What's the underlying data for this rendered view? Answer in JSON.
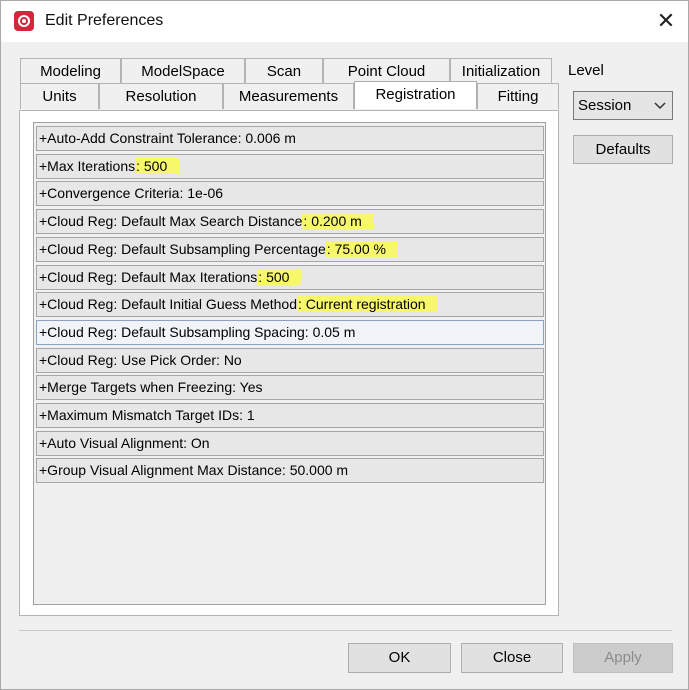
{
  "window": {
    "title": "Edit Preferences",
    "close_symbol": "✕"
  },
  "tabs_row1": [
    "Modeling",
    "ModelSpace",
    "Scan",
    "Point Cloud",
    "Initialization"
  ],
  "tabs_row2": [
    "Units",
    "Resolution",
    "Measurements",
    "Registration",
    "Fitting"
  ],
  "active_tab": "Registration",
  "level": {
    "label": "Level",
    "value": "Session"
  },
  "buttons": {
    "defaults": "Defaults",
    "ok": "OK",
    "close": "Close",
    "apply": "Apply"
  },
  "highlight_color": "#f7f76b",
  "preferences": [
    {
      "label": "+Auto-Add Constraint Tolerance",
      "sep": ": ",
      "value": "0.006 m",
      "highlighted": false
    },
    {
      "label": "+Max Iterations",
      "sep": ": ",
      "value": "500",
      "highlighted": true
    },
    {
      "label": "+Convergence Criteria",
      "sep": ": ",
      "value": "1e-06",
      "highlighted": false
    },
    {
      "label": "+Cloud Reg: Default Max Search Distance",
      "sep": ": ",
      "value": "0.200 m",
      "highlighted": true
    },
    {
      "label": "+Cloud Reg: Default Subsampling Percentage",
      "sep": ": ",
      "value": "75.00 %",
      "highlighted": true
    },
    {
      "label": "+Cloud Reg: Default Max Iterations",
      "sep": ": ",
      "value": "500",
      "highlighted": true
    },
    {
      "label": "+Cloud Reg: Default Initial Guess Method",
      "sep": ": ",
      "value": "Current registration",
      "highlighted": true
    },
    {
      "label": "+Cloud Reg: Default Subsampling Spacing",
      "sep": ": ",
      "value": "0.05 m",
      "highlighted": false,
      "selected": true
    },
    {
      "label": "+Cloud Reg: Use Pick Order",
      "sep": ": ",
      "value": "No",
      "highlighted": false
    },
    {
      "label": "+Merge Targets when Freezing",
      "sep": ": ",
      "value": "Yes",
      "highlighted": false
    },
    {
      "label": "+Maximum Mismatch Target IDs",
      "sep": ": ",
      "value": "1",
      "highlighted": false
    },
    {
      "label": "+Auto Visual Alignment",
      "sep": ": ",
      "value": "On",
      "highlighted": false
    },
    {
      "label": "+Group Visual Alignment Max Distance",
      "sep": ": ",
      "value": "50.000 m",
      "highlighted": false
    }
  ]
}
